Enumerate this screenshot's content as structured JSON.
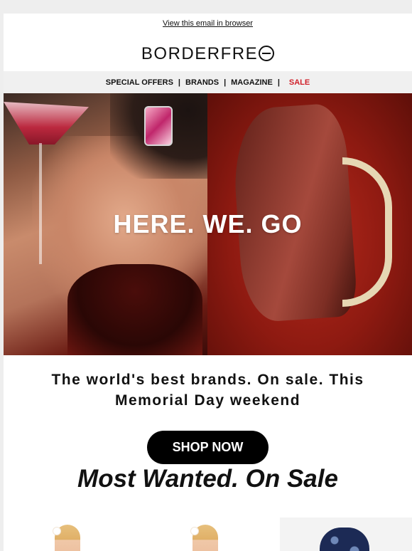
{
  "header": {
    "view_in_browser": "View this email in browser",
    "logo_text": "BORDERFRE"
  },
  "nav": {
    "items": [
      "SPECIAL OFFERS",
      "BRANDS",
      "MAGAZINE"
    ],
    "separator": "|",
    "sale": "SALE"
  },
  "hero": {
    "title": "HERE. WE. GO"
  },
  "main": {
    "headline": "The world's best brands. On sale. This Memorial Day weekend",
    "cta_label": "SHOP NOW",
    "section_title": "Most Wanted. On Sale"
  },
  "colors": {
    "sale": "#d0202a",
    "button_bg": "#000000",
    "nav_bg": "#f0f0f0"
  }
}
